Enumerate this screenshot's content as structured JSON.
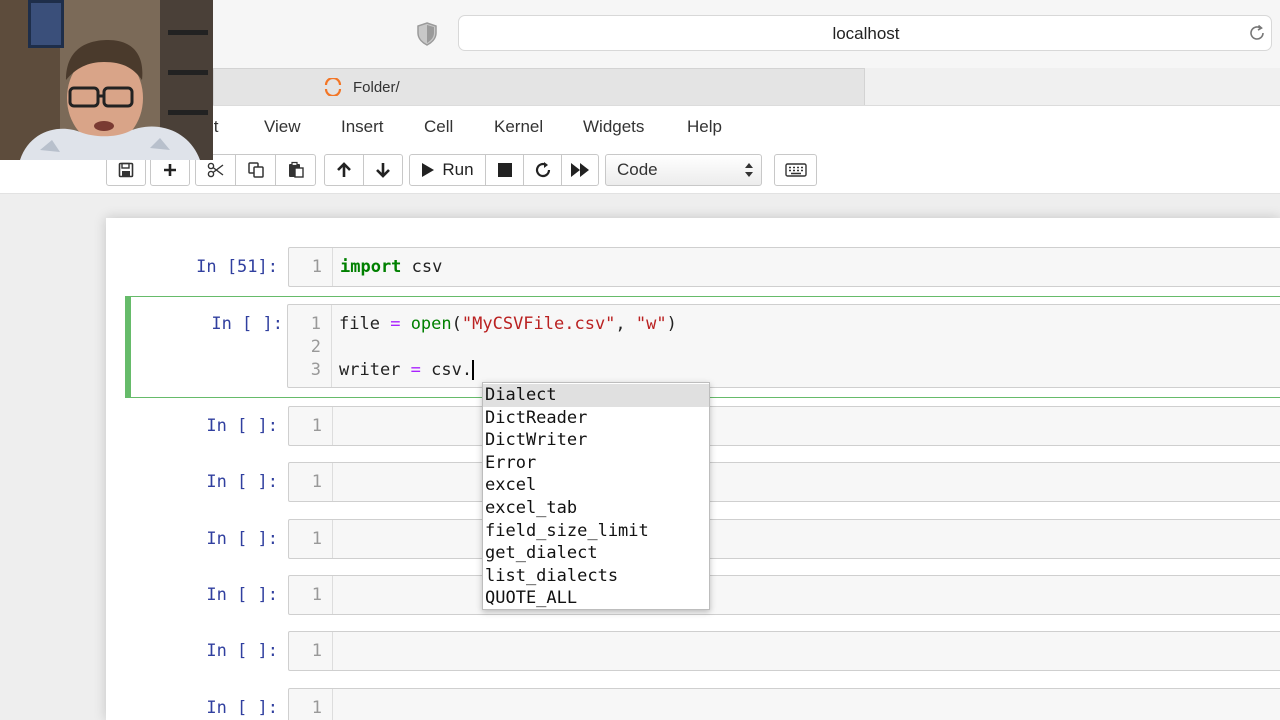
{
  "browser": {
    "url": "localhost",
    "tab_title": "Folder/"
  },
  "menu": [
    "it",
    "View",
    "Insert",
    "Cell",
    "Kernel",
    "Widgets",
    "Help"
  ],
  "toolbar": {
    "run_label": "Run",
    "cell_type": "Code"
  },
  "cells": [
    {
      "prompt": "In [51]:",
      "line_numbers": [
        "1"
      ]
    },
    {
      "prompt": "In [ ]:",
      "line_numbers": [
        "1",
        "2",
        "3"
      ]
    },
    {
      "prompt": "In [ ]:",
      "line_numbers": [
        "1"
      ]
    },
    {
      "prompt": "In [ ]:",
      "line_numbers": [
        "1"
      ]
    },
    {
      "prompt": "In [ ]:",
      "line_numbers": [
        "1"
      ]
    },
    {
      "prompt": "In [ ]:",
      "line_numbers": [
        "1"
      ]
    },
    {
      "prompt": "In [ ]:",
      "line_numbers": [
        "1"
      ]
    },
    {
      "prompt": "In [ ]:",
      "line_numbers": [
        "1"
      ]
    }
  ],
  "code": {
    "c1_kw": "import",
    "c1_rest": " csv",
    "c2_l1_a": "file ",
    "c2_l1_eq": "=",
    "c2_l1_b": " ",
    "c2_l1_fn": "open",
    "c2_l1_c": "(",
    "c2_l1_s1": "\"MyCSVFile.csv\"",
    "c2_l1_d": ", ",
    "c2_l1_s2": "\"w\"",
    "c2_l1_e": ")",
    "c2_l3_a": "writer ",
    "c2_l3_eq": "=",
    "c2_l3_b": " csv."
  },
  "completions": [
    "Dialect",
    "DictReader",
    "DictWriter",
    "Error",
    "excel",
    "excel_tab",
    "field_size_limit",
    "get_dialect",
    "list_dialects",
    "QUOTE_ALL"
  ],
  "colors": {
    "prompt": "#303f9f",
    "keyword": "#008000",
    "string": "#ba2121",
    "operator": "#aa22ff",
    "selected_cell_border": "#66bb6a"
  }
}
